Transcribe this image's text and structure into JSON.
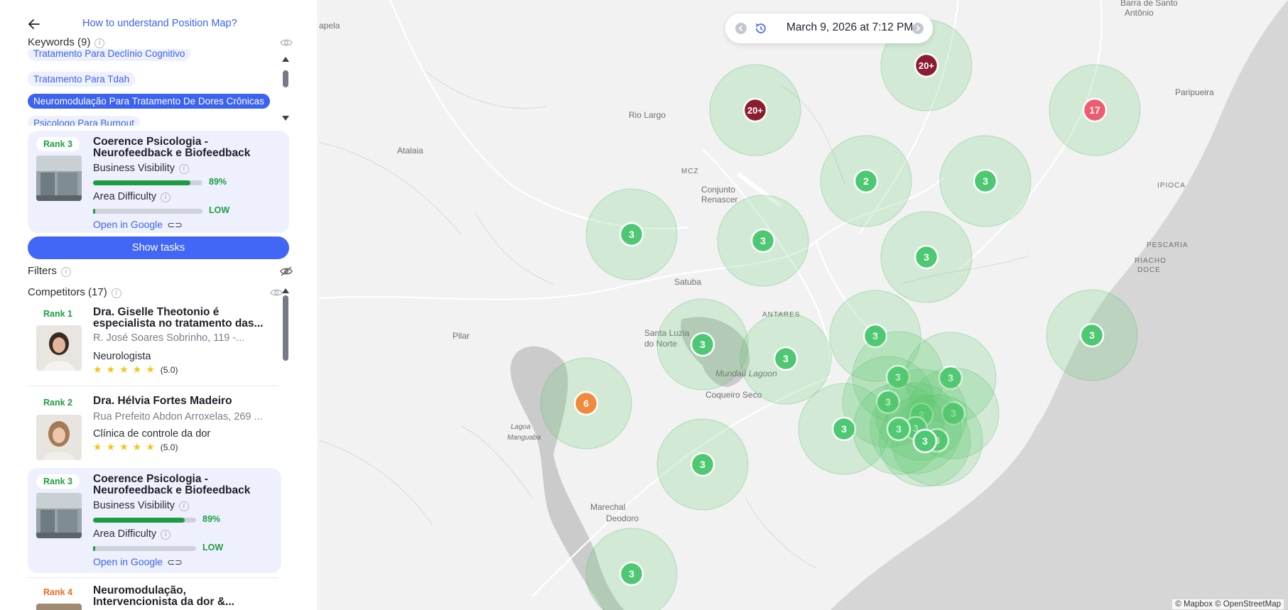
{
  "header": {
    "help_link": "How to understand Position Map?"
  },
  "keywords": {
    "title": "Keywords (9)",
    "items": [
      {
        "label": "Tratamento Para Declínio Cognitivo",
        "active": false
      },
      {
        "label": "Tratamento Para Tdah",
        "active": false
      },
      {
        "label": "Neuromodulação Para Tratamento De Dores Crônicas",
        "active": true
      },
      {
        "label": "Psicologo Para Burnout",
        "active": false
      }
    ]
  },
  "selected_business": {
    "rank": "Rank 3",
    "name_line1": "Coerence Psicologia -",
    "name_line2": "Neurofeedback e Biofeedback",
    "visibility_label": "Business Visibility",
    "visibility_value": "89%",
    "visibility_fraction": 0.89,
    "difficulty_label": "Area Difficulty",
    "difficulty_value": "LOW",
    "open_google": "Open in Google"
  },
  "show_tasks": "Show tasks",
  "filters": {
    "title": "Filters"
  },
  "competitors": {
    "title": "Competitors (17)",
    "items": [
      {
        "rank": "Rank 1",
        "name_line1": "Dra. Giselle Theotonio é",
        "name_line2": "especialista no tratamento das...",
        "address": "R. José Soares Sobrinho, 119 -...",
        "category": "Neurologista",
        "rating": "(5.0)"
      },
      {
        "rank": "Rank 2",
        "name_line1": "Dra. Hélvia Fortes Madeiro",
        "address": "Rua Prefeito Abdon Arroxelas, 269 ...",
        "category": "Clínica de controle da dor",
        "rating": "(5.0)"
      },
      {
        "rank": "Rank 3",
        "name_line1": "Coerence Psicologia -",
        "name_line2": "Neurofeedback e Biofeedback",
        "visibility_label": "Business Visibility",
        "visibility_value": "89%",
        "visibility_fraction": 0.89,
        "difficulty_label": "Area Difficulty",
        "difficulty_value": "LOW",
        "open_google": "Open in Google"
      },
      {
        "rank": "Rank 4",
        "name_line1": "Neuromodulação,",
        "name_line2": "Intervencionista da dor &..."
      }
    ]
  },
  "map": {
    "datetime": "March 9, 2026 at 7:12 PM",
    "attribution": "© Mapbox © OpenStreetMap",
    "place_labels": [
      "Barra de Santo",
      "Antônio",
      "apela",
      "Paripueira",
      "Rio Largo",
      "Atalaia",
      "MCZ",
      "IPIOCA",
      "Conjunto",
      "Renascer",
      "PESCARIA",
      "RIACHO",
      "DOCE",
      "Satuba",
      "ANTARES",
      "Pilar",
      "Santa Luzia",
      "do Norte",
      "Mundaú Lagoon",
      "Coqueiro Seco",
      "Lagoa",
      "Manguaba",
      "Marechal",
      "Deodoro"
    ],
    "markers": [
      {
        "label": "20+",
        "color": "#8b1e2e"
      },
      {
        "label": "20+",
        "color": "#8b1e2e"
      },
      {
        "label": "17",
        "color": "#ef5c6e"
      },
      {
        "label": "2",
        "color": "#4fc874"
      },
      {
        "label": "3",
        "color": "#4fc874"
      },
      {
        "label": "3",
        "color": "#4fc874"
      },
      {
        "label": "3",
        "color": "#4fc874"
      },
      {
        "label": "3",
        "color": "#4fc874"
      },
      {
        "label": "3",
        "color": "#4fc874"
      },
      {
        "label": "3",
        "color": "#4fc874"
      },
      {
        "label": "3",
        "color": "#4fc874"
      },
      {
        "label": "3",
        "color": "#4fc874"
      },
      {
        "label": "6",
        "color": "#f08a3c"
      },
      {
        "label": "3",
        "color": "#4fc874"
      },
      {
        "label": "3",
        "color": "#4fc874"
      },
      {
        "label": "3",
        "color": "#4fc874"
      },
      {
        "label": "2",
        "color": "#4fc874"
      },
      {
        "label": "3",
        "color": "#4fc874"
      },
      {
        "label": "3",
        "color": "#4fc874"
      },
      {
        "label": "3",
        "color": "#4fc874"
      },
      {
        "label": "3",
        "color": "#4fc874"
      },
      {
        "label": "3",
        "color": "#4fc874"
      },
      {
        "label": "3",
        "color": "#4fc874"
      },
      {
        "label": "3",
        "color": "#4fc874"
      },
      {
        "label": "3",
        "color": "#4fc874"
      }
    ]
  },
  "colors": {
    "accent": "#4266f5",
    "success": "#1f9c43",
    "rank4": "#f06a1c"
  }
}
